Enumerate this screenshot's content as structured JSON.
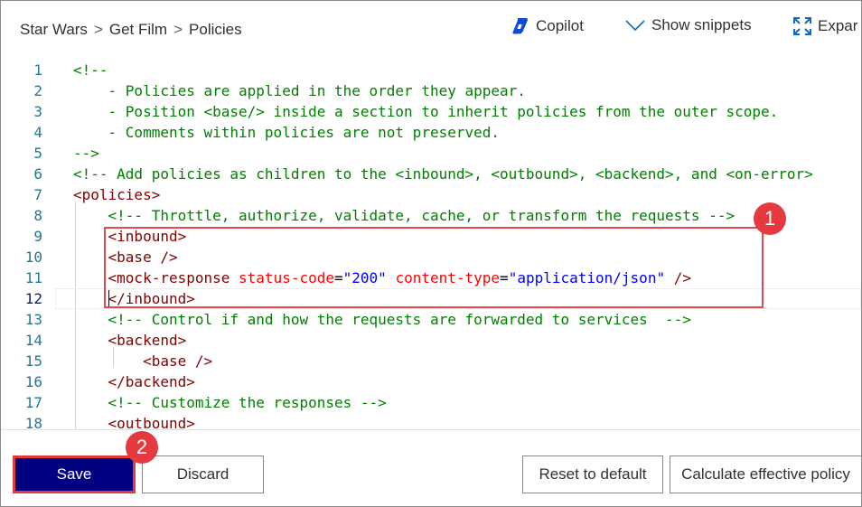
{
  "breadcrumb": [
    "Star Wars",
    "Get Film",
    "Policies"
  ],
  "breadcrumb_sep": ">",
  "toolbar": {
    "copilot": "Copilot",
    "snippets": "Show snippets",
    "expand": "Expar"
  },
  "editor": {
    "current_line": 12,
    "line_numbers": [
      "1",
      "2",
      "3",
      "4",
      "5",
      "6",
      "7",
      "8",
      "9",
      "10",
      "11",
      "12",
      "13",
      "14",
      "15",
      "16",
      "17",
      "18"
    ],
    "lines": [
      [
        {
          "t": "<!--",
          "c": "comment"
        }
      ],
      [
        {
          "t": "    - Policies are applied in the order they appear.",
          "c": "comment"
        }
      ],
      [
        {
          "t": "    - Position <base/> inside a section to inherit policies from the outer scope.",
          "c": "comment"
        }
      ],
      [
        {
          "t": "    - Comments within policies are not preserved.",
          "c": "comment"
        }
      ],
      [
        {
          "t": "-->",
          "c": "comment"
        }
      ],
      [
        {
          "t": "<!-- Add policies as children to the <inbound>, <outbound>, <backend>, and <on-error>",
          "c": "comment"
        }
      ],
      [
        {
          "t": "<policies>",
          "c": "tag"
        }
      ],
      [
        {
          "t": "    <!-- Throttle, authorize, validate, cache, or transform the requests -->",
          "c": "comment"
        }
      ],
      [
        {
          "t": "    ",
          "c": "plain"
        },
        {
          "t": "<inbound>",
          "c": "tag"
        }
      ],
      [
        {
          "t": "    ",
          "c": "plain"
        },
        {
          "t": "<base />",
          "c": "tag"
        }
      ],
      [
        {
          "t": "    ",
          "c": "plain"
        },
        {
          "t": "<mock-response ",
          "c": "tag"
        },
        {
          "t": "status-code",
          "c": "attr"
        },
        {
          "t": "=",
          "c": "plain"
        },
        {
          "t": "\"200\"",
          "c": "str"
        },
        {
          "t": " ",
          "c": "plain"
        },
        {
          "t": "content-type",
          "c": "attr"
        },
        {
          "t": "=",
          "c": "plain"
        },
        {
          "t": "\"application/json\"",
          "c": "str"
        },
        {
          "t": " />",
          "c": "tag"
        }
      ],
      [
        {
          "t": "    ",
          "c": "plain"
        },
        {
          "t": "</inbound>",
          "c": "tag"
        }
      ],
      [
        {
          "t": "    <!-- Control if and how the requests are forwarded to services  -->",
          "c": "comment"
        }
      ],
      [
        {
          "t": "    ",
          "c": "plain"
        },
        {
          "t": "<backend>",
          "c": "tag"
        }
      ],
      [
        {
          "t": "        ",
          "c": "plain"
        },
        {
          "t": "<base />",
          "c": "tag"
        }
      ],
      [
        {
          "t": "    ",
          "c": "plain"
        },
        {
          "t": "</backend>",
          "c": "tag"
        }
      ],
      [
        {
          "t": "    <!-- Customize the responses -->",
          "c": "comment"
        }
      ],
      [
        {
          "t": "    ",
          "c": "plain"
        },
        {
          "t": "<outbound>",
          "c": "tag"
        }
      ]
    ]
  },
  "callouts": {
    "one": "1",
    "two": "2"
  },
  "buttons": {
    "save": "Save",
    "discard": "Discard",
    "reset": "Reset to default",
    "calculate": "Calculate effective policy"
  },
  "colors": {
    "primary": "#000080",
    "callout": "#e4393f",
    "comment": "#008000",
    "tag": "#800000",
    "attr": "#ff0000",
    "string": "#0000ff",
    "line_number": "#237893"
  },
  "icons": {
    "copilot": "copilot-icon",
    "snippets": "chevron-down-icon",
    "expand": "expand-icon"
  }
}
